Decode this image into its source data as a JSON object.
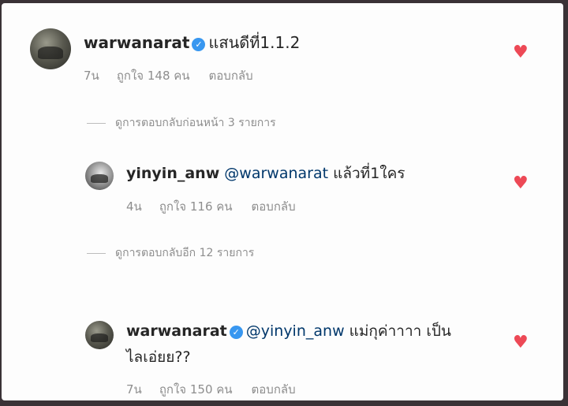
{
  "comments": [
    {
      "username": "warwanarat",
      "verified": true,
      "text": "แสนดีที่1.1.2",
      "time": "7น",
      "likes": "ถูกใจ 148 คน",
      "reply": "ตอบกลับ"
    },
    {
      "username": "yinyin_anw",
      "verified": false,
      "mention": "@warwanarat",
      "text": "แล้วที่1ใคร",
      "time": "4น",
      "likes": "ถูกใจ 116 คน",
      "reply": "ตอบกลับ"
    },
    {
      "username": "warwanarat",
      "verified": true,
      "mention": "@yinyin_anw",
      "text": "แม่กุค่าาาา เป็น",
      "text2": "ไลเอ่ยย??",
      "time": "7น",
      "likes": "ถูกใจ 150 คน",
      "reply": "ตอบกลับ"
    }
  ],
  "view_replies": [
    "ดูการตอบกลับก่อนหน้า 3 รายการ",
    "ดูการตอบกลับอีก 12 รายการ"
  ],
  "icons": {
    "verified": "✓",
    "heart": "♥"
  },
  "colors": {
    "heart": "#ed4956",
    "verified": "#3897f0",
    "mention": "#00376b"
  }
}
